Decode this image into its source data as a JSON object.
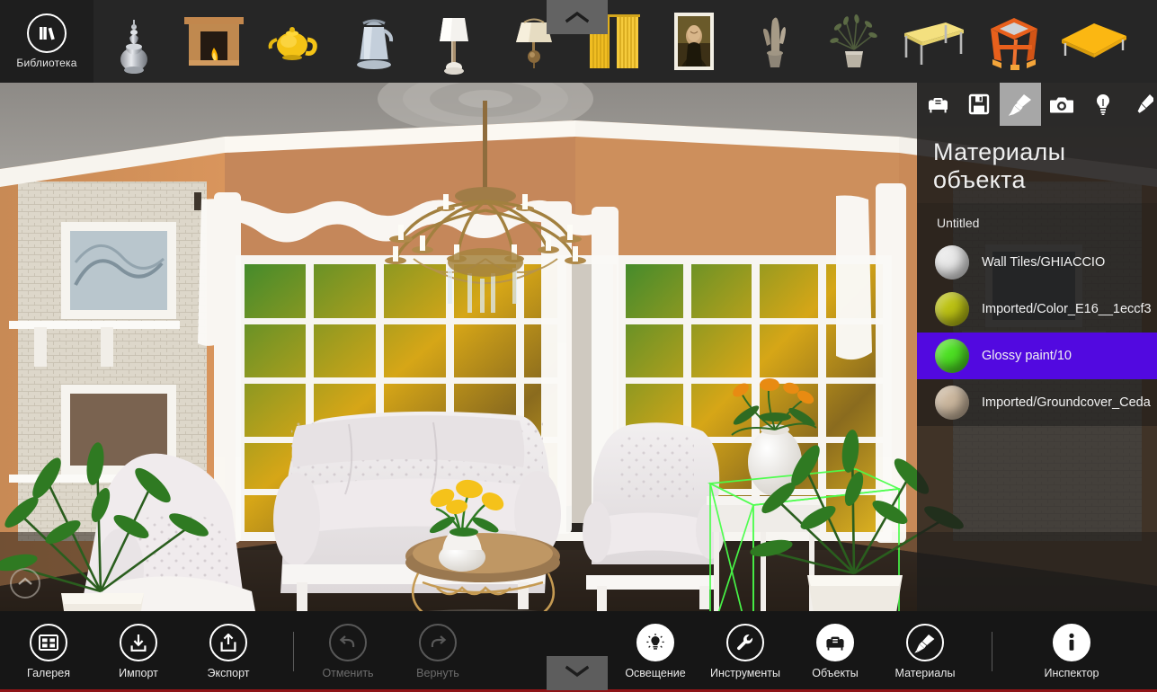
{
  "app": {
    "title": "Interior Design 3D",
    "accent_color": "#8e1418",
    "selection_color": "#5209e0",
    "wireframe_color": "#49ff49"
  },
  "library": {
    "button_label": "Библиотека",
    "button_icon": "books-icon",
    "collapse_icon": "chevron-up-icon",
    "items": [
      {
        "name": "silver-vase",
        "label": "Silver vase"
      },
      {
        "name": "fireplace",
        "label": "Fireplace"
      },
      {
        "name": "yellow-teapot",
        "label": "Yellow teapot"
      },
      {
        "name": "blue-kettle",
        "label": "Blue kettle"
      },
      {
        "name": "table-lamp",
        "label": "Table lamp"
      },
      {
        "name": "wall-sconce",
        "label": "Wall sconce"
      },
      {
        "name": "yellow-curtains",
        "label": "Yellow curtains"
      },
      {
        "name": "framed-painting",
        "label": "Framed painting"
      },
      {
        "name": "potted-cactus",
        "label": "Potted cactus"
      },
      {
        "name": "potted-plant",
        "label": "Potted plant"
      },
      {
        "name": "yellow-table",
        "label": "Yellow table"
      },
      {
        "name": "orange-stand",
        "label": "Orange stand"
      },
      {
        "name": "yellow-platform",
        "label": "Yellow platform"
      }
    ]
  },
  "viewport": {
    "collapse_icon": "chevron-up-icon",
    "scene_description": "Classical living room 3D render with chandelier, bay windows, sofa, armchairs, coffee table and potted plants"
  },
  "right_panel": {
    "title": "Материалы объекта",
    "subtitle": "Untitled",
    "tabs": [
      {
        "name": "objects-tab",
        "icon": "sofa-icon",
        "active": false
      },
      {
        "name": "save-tab",
        "icon": "floppy-disk-icon",
        "active": false
      },
      {
        "name": "materials-tab",
        "icon": "paint-brush-icon",
        "active": true
      },
      {
        "name": "camera-tab",
        "icon": "camera-icon",
        "active": false
      },
      {
        "name": "lighting-tab",
        "icon": "lightbulb-icon",
        "active": false
      },
      {
        "name": "more-tab",
        "icon": "paint-brush-icon",
        "active": false
      }
    ],
    "materials": [
      {
        "name": "Wall Tiles/GHIACCIO",
        "color": "#e9e9e9",
        "selected": false
      },
      {
        "name": "Imported/Color_E16__1eccf3",
        "color": "#bcc214",
        "selected": false
      },
      {
        "name": "Glossy paint/10",
        "color": "#4de023",
        "selected": true
      },
      {
        "name": "Imported/Groundcover_Ceda",
        "color": "#cbb79e",
        "selected": false
      }
    ]
  },
  "bottom_toolbar": {
    "collapse_icon": "chevron-down-icon",
    "left_items": [
      {
        "name": "gallery-button",
        "label": "Галерея",
        "icon": "gallery-icon",
        "disabled": false
      },
      {
        "name": "import-button",
        "label": "Импорт",
        "icon": "import-icon",
        "disabled": false
      },
      {
        "name": "export-button",
        "label": "Экспорт",
        "icon": "export-icon",
        "disabled": false
      }
    ],
    "history_items": [
      {
        "name": "undo-button",
        "label": "Отменить",
        "icon": "undo-icon",
        "disabled": true
      },
      {
        "name": "redo-button",
        "label": "Вернуть",
        "icon": "redo-icon",
        "disabled": true
      }
    ],
    "right_items": [
      {
        "name": "lighting-button",
        "label": "Освещение",
        "icon": "lightbulb-icon",
        "disabled": false
      },
      {
        "name": "tools-button",
        "label": "Инструменты",
        "icon": "wrench-icon",
        "disabled": false
      },
      {
        "name": "objects-button",
        "label": "Объекты",
        "icon": "sofa-icon",
        "disabled": false
      },
      {
        "name": "materials-button",
        "label": "Материалы",
        "icon": "paint-brush-icon",
        "disabled": false
      }
    ],
    "inspector_item": {
      "name": "inspector-button",
      "label": "Инспектор",
      "icon": "info-icon",
      "disabled": false
    }
  }
}
